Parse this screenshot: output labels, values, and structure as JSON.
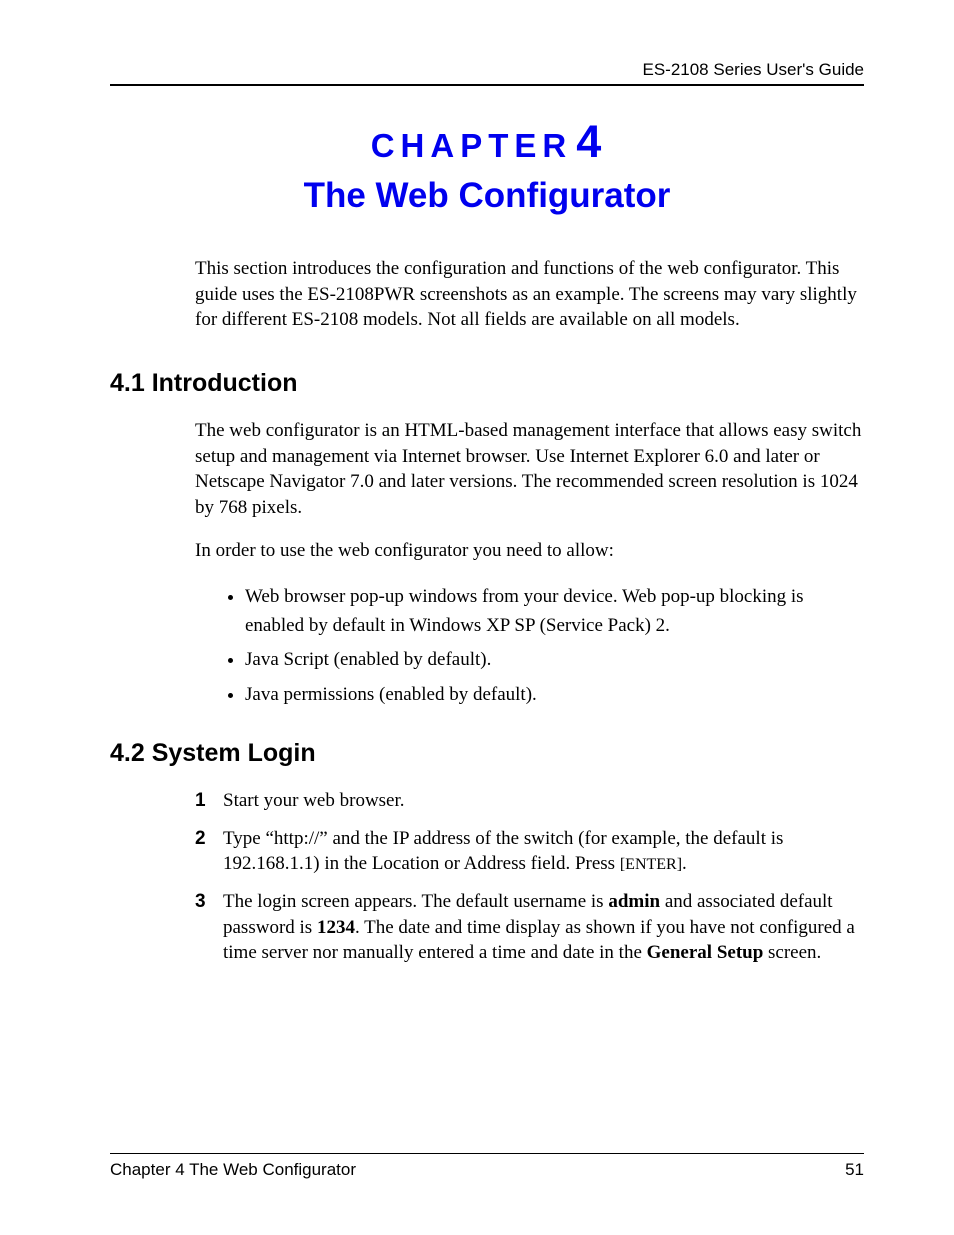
{
  "header": {
    "guide_title": "ES-2108 Series User's Guide"
  },
  "chapter": {
    "label": "CHAPTER",
    "number": "4",
    "title": "The Web Configurator",
    "intro": "This section introduces the configuration and functions of the web configurator. This guide uses the ES-2108PWR screenshots as an example. The screens may vary slightly for different ES-2108 models. Not all fields are available on all models."
  },
  "section1": {
    "heading": "4.1  Introduction",
    "para1": "The web configurator is an HTML-based management interface that allows easy switch setup and management via Internet browser. Use Internet Explorer 6.0 and later or Netscape Navigator 7.0 and later versions. The recommended screen resolution is 1024 by 768 pixels.",
    "para2": "In order to use the web configurator you need to allow:",
    "bullets": [
      "Web browser pop-up windows from your device. Web pop-up blocking is enabled by default in Windows XP SP (Service Pack) 2.",
      "Java Script (enabled by default).",
      "Java permissions (enabled by default)."
    ]
  },
  "section2": {
    "heading": "4.2  System Login",
    "steps": {
      "s1": "Start your web browser.",
      "s2_a": "Type “http://” and the IP address of the switch (for example, the default is 192.168.1.1) in the Location or Address field. Press ",
      "s2_b": "[ENTER]",
      "s2_c": ".",
      "s3_a": "The login screen appears. The default username is ",
      "s3_b": "admin",
      "s3_c": " and associated default password is ",
      "s3_d": "1234",
      "s3_e": ". The date and time display as shown if you have not configured a time server nor manually entered a time and date in the ",
      "s3_f": "General Setup",
      "s3_g": " screen."
    }
  },
  "footer": {
    "left": "Chapter 4 The Web Configurator",
    "right": "51"
  }
}
